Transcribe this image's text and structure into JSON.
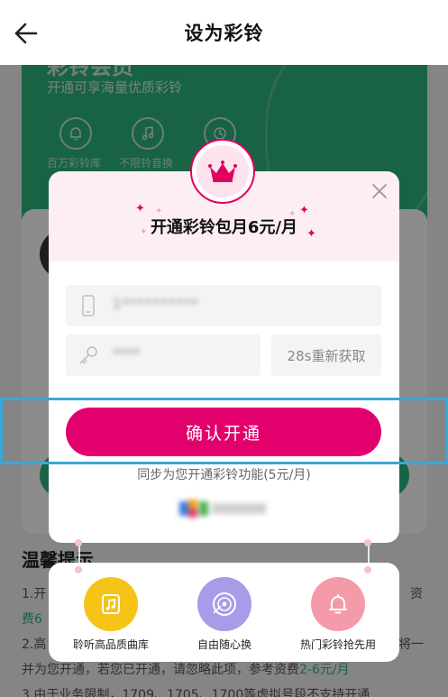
{
  "header": {
    "title": "设为彩铃"
  },
  "background": {
    "card_title": "彩铃会员",
    "card_subtitle": "开通可享海量优质彩铃",
    "card_icons": [
      {
        "icon": "bell-icon",
        "label": "百万彩铃库"
      },
      {
        "icon": "music-note-icon",
        "label": "不限铃音换"
      },
      {
        "icon": "clock-icon",
        "label": ""
      }
    ],
    "tips_title": "温馨提示",
    "tips": [
      {
        "prefix": "1.开",
        "suffix": "资"
      },
      {
        "prefix": "费6",
        "suffix": ""
      },
      {
        "prefix": "2.高",
        "suffix": "将一"
      },
      {
        "prefix": "并为您开通，若您已开通，请忽略此项，参考资费",
        "accent": "2-6元/月",
        "suffix": ""
      },
      {
        "prefix": "3.由于业务限制，1709、1705、1700等虚拟号段不支持开通",
        "suffix": ""
      }
    ]
  },
  "modal": {
    "title": "开通彩铃包月6元/月",
    "phone_value": "1**********",
    "code_value": "****",
    "resend_label": "28s重新获取",
    "confirm_label": "确认开通",
    "sync_text": "同步为您开通彩铃功能(5元/月)"
  },
  "features": [
    {
      "icon": "music-library-icon",
      "label": "聆听高品质曲库",
      "color": "#f6c317"
    },
    {
      "icon": "vinyl-record-icon",
      "label": "自由随心换",
      "color": "#a89be8"
    },
    {
      "icon": "bell-icon",
      "label": "热门彩铃抢先用",
      "color": "#f59aa8"
    }
  ],
  "colors": {
    "accent": "#e2006c",
    "green": "#2fb47e",
    "highlight": "#3aa8d8"
  }
}
